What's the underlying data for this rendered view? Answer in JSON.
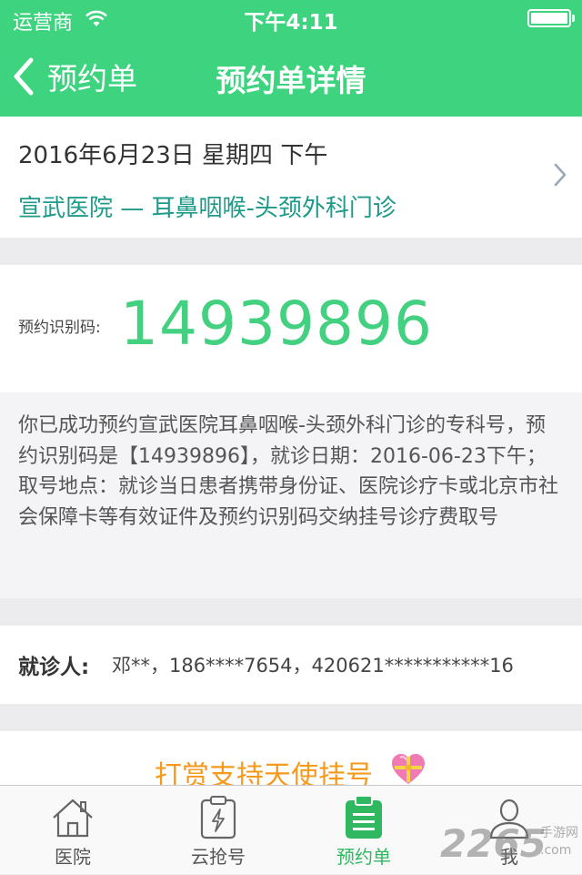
{
  "status_bar": {
    "carrier": "运营商",
    "time": "下午4:11"
  },
  "nav": {
    "back_label": "预约单",
    "title": "预约单详情"
  },
  "appointment": {
    "date": "2016年6月23日 星期四 下午",
    "hospital_dept": "宣武医院 — 耳鼻咽喉-头颈外科门诊"
  },
  "code": {
    "label": "预约识别码:",
    "value": "14939896",
    "description": "你已成功预约宣武医院耳鼻咽喉-头颈外科门诊的专科号，预约识别码是【14939896】，就诊日期：2016-06-23下午；取号地点：就诊当日患者携带身份证、医院诊疗卡或北京市社会保障卡等有效证件及预约识别码交纳挂号诊疗费取号"
  },
  "patient": {
    "label": "就诊人:",
    "value": "邓**，186****7654，420621***********16"
  },
  "tip": {
    "text": "打赏支持天使挂号"
  },
  "tabs": [
    {
      "label": "医院",
      "icon": "hospital-icon",
      "active": false
    },
    {
      "label": "云抢号",
      "icon": "clipboard-flash-icon",
      "active": false
    },
    {
      "label": "预约单",
      "icon": "clipboard-list-icon",
      "active": true
    },
    {
      "label": "我",
      "icon": "user-icon",
      "active": false
    }
  ],
  "watermark": {
    "number": "2265",
    "cn": "手游网",
    "url": ".com"
  },
  "colors": {
    "header_bg": "#3ed37f",
    "code_green": "#44d081",
    "dept_teal": "#1e9a8a",
    "tip_orange": "#f59a1d",
    "tab_active": "#2fb85f"
  }
}
